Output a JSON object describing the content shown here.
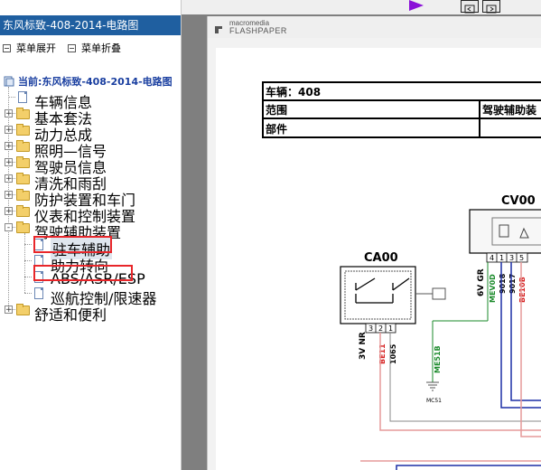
{
  "left_panel": {
    "title": "东风标致-408-2014-电路图",
    "menu": {
      "expand": "菜单展开",
      "collapse": "菜单折叠"
    },
    "current": "当前:东风标致-408-2014-电路图",
    "tree": [
      {
        "label": "车辆信息",
        "type": "page"
      },
      {
        "label": "基本套法",
        "type": "folder",
        "state": "+"
      },
      {
        "label": "动力总成",
        "type": "folder",
        "state": "+"
      },
      {
        "label": "照明—信号",
        "type": "folder",
        "state": "+"
      },
      {
        "label": "驾驶员信息",
        "type": "folder",
        "state": "+"
      },
      {
        "label": "清洗和雨刮",
        "type": "folder",
        "state": "+"
      },
      {
        "label": "防护装置和车门",
        "type": "folder",
        "state": "+"
      },
      {
        "label": "仪表和控制装置",
        "type": "folder",
        "state": "+"
      },
      {
        "label": "驾驶辅助装置",
        "type": "folder",
        "state": "-"
      },
      {
        "label": "驻车辅助",
        "type": "page",
        "selected": true,
        "highlighted": true
      },
      {
        "label": "助力转向",
        "type": "page"
      },
      {
        "label": "ABS/ASR/ESP",
        "type": "page",
        "highlighted": true
      },
      {
        "label": "巡航控制/限速器",
        "type": "page"
      },
      {
        "label": "舒适和便利",
        "type": "folder",
        "state": "+"
      }
    ]
  },
  "viewer": {
    "brand_top": "macromedia",
    "brand_bottom": "FLASHPAPER",
    "table": {
      "row1": "车辆：408",
      "row2_left": "范围",
      "row2_right": "驾驶辅助装",
      "row3": "部件"
    },
    "diagram": {
      "ca00": "CA00",
      "cv00": "CV00",
      "ca00_pins": [
        "3",
        "2",
        "1"
      ],
      "cv00_pins": [
        "4",
        "1",
        "3",
        "5"
      ],
      "wires_left": [
        "3V NR",
        "BE11",
        "1065"
      ],
      "wires_right": [
        "6V GR",
        "MEV0D",
        "9018",
        "9017",
        "BE10B"
      ],
      "ground_wire": "ME51B",
      "ground_label": "MC51"
    }
  },
  "colors": {
    "title_bar": "#1f5fa0",
    "highlight": "#e8262a",
    "wire_red": "#d62020",
    "wire_green": "#1a8a2a",
    "wire_blue": "#1c2ea6",
    "wire_pink": "#e59a9a"
  }
}
